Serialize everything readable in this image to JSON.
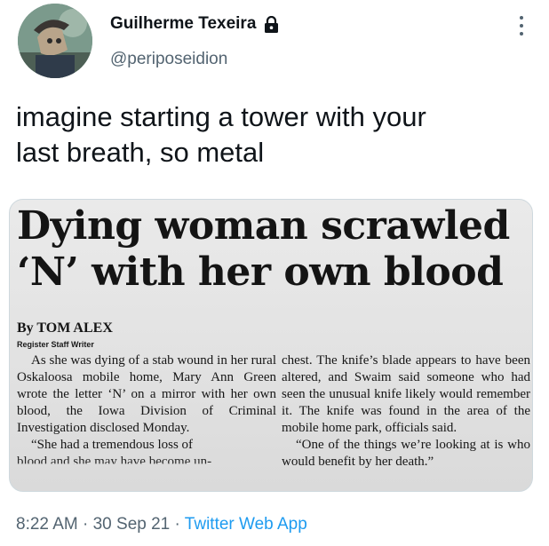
{
  "tweet": {
    "display_name": "Guilherme Texeira",
    "handle": "@periposeidion",
    "text": "imagine starting a tower with your\nlast breath, so metal",
    "time": "8:22 AM",
    "separator_1": " · ",
    "date": "30 Sep 21",
    "separator_2": " · ",
    "source": "Twitter Web App",
    "icons": [
      "lock-icon",
      "more-icon"
    ],
    "colors": {
      "link": "#1d9bf0",
      "secondary_text": "#536471",
      "primary_text": "#0f1419"
    }
  },
  "article": {
    "headline": "Dying woman scrawled\n‘N’ with her own blood",
    "byline": "By TOM ALEX",
    "staff_line": "Register Staff Writer",
    "left_paragraph_1": "As she was dying of a stab wound in her rural Oskaloosa mobile home, Mary Ann Green wrote the letter ‘N’ on a mirror with her own blood, the Iowa Division of Criminal Investigation disclosed Monday.",
    "left_paragraph_2": "“She had a tremendous loss of",
    "left_cut_line": "blood and she may have become un-",
    "right_paragraph_1": "chest. The knife’s blade appears to have been altered, and Swaim said someone who had seen the unusual knife likely would remember it. The knife was found in the area of the mobile home park, officials said.",
    "right_paragraph_2": "“One of the things we’re looking at is who would benefit by her death.”"
  }
}
